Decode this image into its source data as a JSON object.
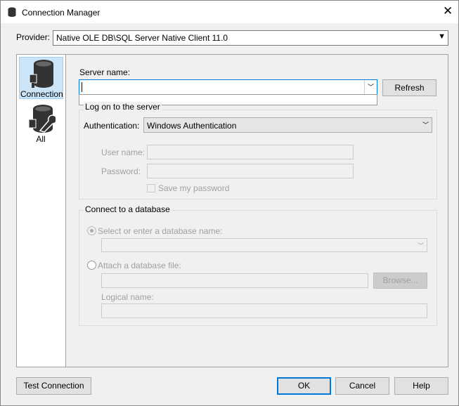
{
  "title": "Connection Manager",
  "provider": {
    "label": "Provider:",
    "value": "Native OLE DB\\SQL Server Native Client 11.0"
  },
  "sidebar": {
    "items": [
      {
        "label": "Connection"
      },
      {
        "label": "All"
      }
    ]
  },
  "server": {
    "label": "Server name:",
    "value": "",
    "refresh": "Refresh"
  },
  "logon": {
    "title": "Log on to the server",
    "auth_label": "Authentication:",
    "auth_value": "Windows Authentication",
    "user_label": "User name:",
    "password_label": "Password:",
    "save_password": "Save my password"
  },
  "database": {
    "title": "Connect to a database",
    "select_label": "Select or enter a database name:",
    "attach_label": "Attach a database file:",
    "browse": "Browse...",
    "logical_label": "Logical name:"
  },
  "buttons": {
    "test": "Test Connection",
    "ok": "OK",
    "cancel": "Cancel",
    "help": "Help"
  }
}
